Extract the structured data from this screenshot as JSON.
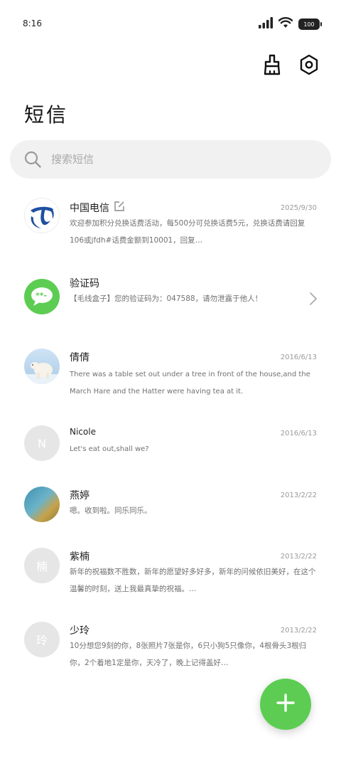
{
  "status_bar": {
    "time": "8:16",
    "battery": "100"
  },
  "header": {
    "title": "短信"
  },
  "search": {
    "placeholder": "搜索短信"
  },
  "conversations": [
    {
      "name": "中国电信",
      "date": "2025/9/30",
      "snippet": "欢迎参加积分兑换话费活动，每500分可兑换话费5元，兑换话费请回复106或jfdh#话费金额到10001，回复…",
      "avatar": "china-telecom-logo",
      "has_edit_badge": true
    },
    {
      "name": "验证码",
      "date": "",
      "snippet": "【毛线盒子】您的验证码为：047588，请勿泄露于他人！",
      "avatar": "message-bubble-icon",
      "has_chevron": true
    },
    {
      "name": "倩倩",
      "date": "2016/6/13",
      "snippet": "There was a table set out under a tree in front of the house,and the March Hare and the Hatter were having tea at it.",
      "avatar": "polar-bear-photo"
    },
    {
      "name": "Nicole",
      "date": "2016/6/13",
      "snippet": "Let's eat out,shall we?",
      "avatar_letter": "N"
    },
    {
      "name": "燕婷",
      "date": "2013/2/22",
      "snippet": "嗯。收到啦。同乐同乐。",
      "avatar": "ocean-photo"
    },
    {
      "name": "紫楠",
      "date": "2013/2/22",
      "snippet": "新年的祝福数不胜数，新年的愿望好多好多，新年的问候依旧美好，在这个温馨的时刻，送上我最真挚的祝福。…",
      "avatar_letter": "楠"
    },
    {
      "name": "少玲",
      "date": "2013/2/22",
      "snippet": "10分想您9刻的你，8张照片7张是你，6只小狗5只像你，4根骨头3根归你，2个着地1定是你，天冷了，晚上记得盖好…",
      "avatar_letter": "玲"
    }
  ],
  "colors": {
    "accent": "#5ccd52",
    "telecom_blue": "#1f4fa0",
    "avatar_gray": "#e6e6e6"
  }
}
